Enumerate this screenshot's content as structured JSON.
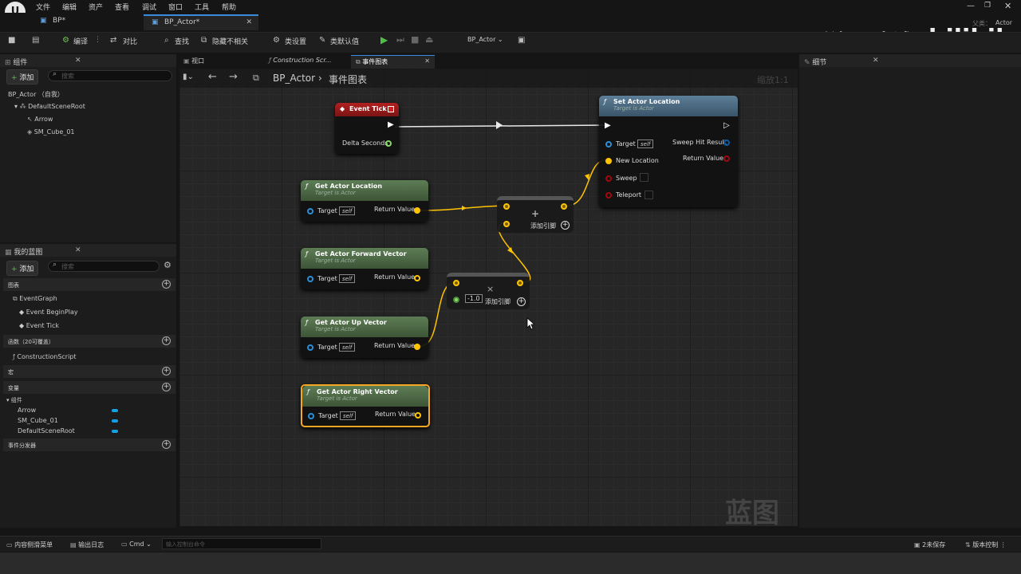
{
  "menu": [
    "文件",
    "编辑",
    "资产",
    "查看",
    "调试",
    "窗口",
    "工具",
    "帮助"
  ],
  "doc_tabs": [
    "BP*",
    "BP_Actor*"
  ],
  "window": {
    "parent_label": "父类：",
    "parent_value": "Actor"
  },
  "watermark": {
    "text": "乔治-周士诚"
  },
  "toolbar": {
    "compile": "编译",
    "diff": "对比",
    "find": "查找",
    "hide_unrelated": "隐藏不相关",
    "class_settings": "类设置",
    "class_defaults": "类默认值",
    "debug_object": "BP_Actor"
  },
  "panel_tabs": [
    "视口",
    "Construction Scr...",
    "事件图表"
  ],
  "components": {
    "title": "组件",
    "add": "添加",
    "search_placeholder": "搜索",
    "root": "BP_Actor （自我）",
    "items": [
      "DefaultSceneRoot",
      "Arrow",
      "SM_Cube_01"
    ]
  },
  "details": {
    "title": "细节"
  },
  "my_blueprint": {
    "title": "我的蓝图",
    "add": "添加",
    "search_placeholder": "搜索",
    "graphs_label": "图表",
    "event_graph": "EventGraph",
    "events": [
      "Event BeginPlay",
      "Event Tick"
    ],
    "functions_label": "函数（20可覆盖）",
    "construction": "ConstructionScript",
    "macros_label": "宏",
    "variables_label": "变量",
    "components_label": "组件",
    "variables": [
      "Arrow",
      "SM_Cube_01",
      "DefaultSceneRoot"
    ],
    "dispatchers_label": "事件分发器"
  },
  "graph": {
    "breadcrumb_bp": "BP_Actor",
    "breadcrumb_graph": "事件图表",
    "zoom": "缩放1:1",
    "watermark": "蓝图",
    "event_tick": {
      "title": "Event Tick",
      "pin": "Delta Seconds"
    },
    "set_loc": {
      "title": "Set Actor Location",
      "sub": "Target is Actor",
      "target": "Target",
      "self": "self",
      "new_location": "New Location",
      "sweep": "Sweep",
      "teleport": "Teleport",
      "sweep_hit": "Sweep Hit Result",
      "return": "Return Value"
    },
    "get_loc": {
      "title": "Get Actor Location",
      "sub": "Target is Actor",
      "target": "Target",
      "self": "self",
      "return": "Return Value"
    },
    "get_fwd": {
      "title": "Get Actor Forward Vector",
      "sub": "Target is Actor",
      "target": "Target",
      "self": "self",
      "return": "Return Value"
    },
    "get_up": {
      "title": "Get Actor Up Vector",
      "sub": "Target is Actor",
      "target": "Target",
      "self": "self",
      "return": "Return Value"
    },
    "get_right": {
      "title": "Get Actor Right Vector",
      "sub": "Target is Actor",
      "target": "Target",
      "self": "self",
      "return": "Return Value"
    },
    "add_node": {
      "symbol": "+",
      "add_pin": "添加引脚"
    },
    "mul_node": {
      "symbol": "×",
      "value": "-1.0",
      "add_pin": "添加引脚"
    }
  },
  "status": {
    "content_drawer": "内容侧滑菜单",
    "output_log": "输出日志",
    "cmd": "Cmd",
    "cmd_placeholder": "输入控制台命令",
    "unsaved": "2未保存",
    "source_control": "版本控制"
  }
}
